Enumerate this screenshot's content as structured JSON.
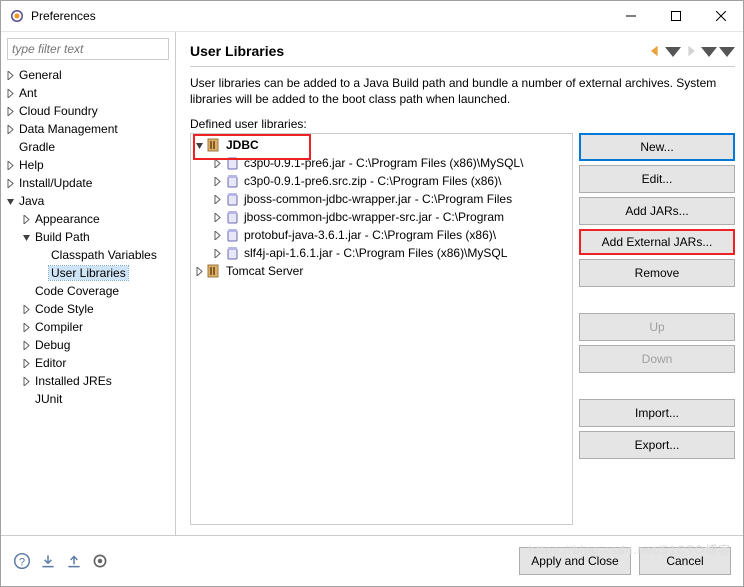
{
  "window": {
    "title": "Preferences"
  },
  "filter": {
    "placeholder": "type filter text"
  },
  "nav": {
    "general": "General",
    "ant": "Ant",
    "cloud_foundry": "Cloud Foundry",
    "data_management": "Data Management",
    "gradle": "Gradle",
    "help": "Help",
    "install_update": "Install/Update",
    "java": "Java",
    "appearance": "Appearance",
    "build_path": "Build Path",
    "classpath_v": "Classpath Variables",
    "user_libraries": "User Libraries",
    "code_coverage": "Code Coverage",
    "code_style": "Code Style",
    "compiler": "Compiler",
    "debug": "Debug",
    "editor": "Editor",
    "installed_jres": "Installed JREs",
    "junit": "JUnit"
  },
  "panel": {
    "heading": "User Libraries",
    "desc": "User libraries can be added to a Java Build path and bundle a number of external archives. System libraries will be added to the boot class path when launched.",
    "defined_label": "Defined user libraries:"
  },
  "libs": {
    "jdbc": "JDBC",
    "j1": "c3p0-0.9.1-pre6.jar - C:\\Program Files (x86)\\MySQL\\",
    "j2": "c3p0-0.9.1-pre6.src.zip - C:\\Program Files (x86)\\",
    "j3": "jboss-common-jdbc-wrapper.jar - C:\\Program Files",
    "j4": "jboss-common-jdbc-wrapper-src.jar - C:\\Program",
    "j5": "protobuf-java-3.6.1.jar - C:\\Program Files (x86)\\",
    "j6": "slf4j-api-1.6.1.jar - C:\\Program Files (x86)\\MySQL",
    "tomcat": "Tomcat Server"
  },
  "buttons": {
    "new": "New...",
    "edit": "Edit...",
    "add_jars": "Add JARs...",
    "add_ext_jars": "Add External JARs...",
    "remove": "Remove",
    "up": "Up",
    "down": "Down",
    "import": "Import...",
    "export": "Export..."
  },
  "footer": {
    "apply_close": "Apply and Close",
    "cancel": "Cancel"
  },
  "watermark": "https://blog.csdn.net/51CTO博客"
}
